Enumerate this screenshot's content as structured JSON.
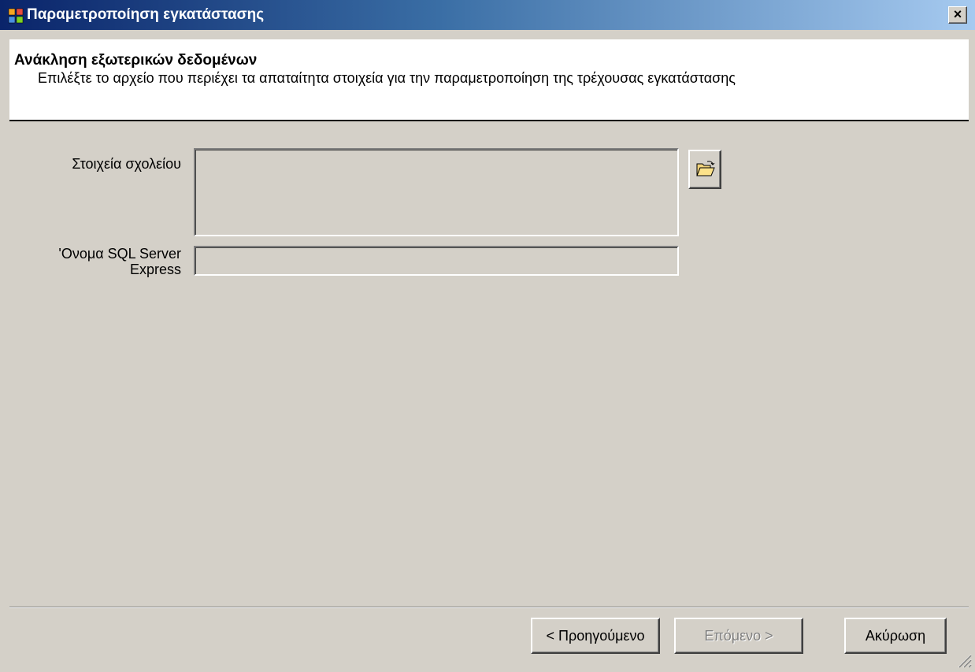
{
  "window": {
    "title": "Παραμετροποίηση εγκατάστασης",
    "close_label": "×"
  },
  "header": {
    "title": "Ανάκληση εξωτερικών δεδομένων",
    "description": "Επιλέξτε το αρχείο που περιέχει τα απαταίτητα στοιχεία για την παραμετροποίηση της τρέχουσας εγκατάστασης"
  },
  "form": {
    "school_label": "Στοιχεία σχολείου",
    "school_value": "",
    "browse_icon": "open-folder-icon",
    "sql_label_line1": "'Ονομα SQL Server",
    "sql_label_line2": "Express",
    "sql_value": ""
  },
  "buttons": {
    "back_label": "< Προηγούμενο",
    "next_label": "Επόμενο >",
    "next_enabled": false,
    "cancel_label": "Ακύρωση"
  }
}
